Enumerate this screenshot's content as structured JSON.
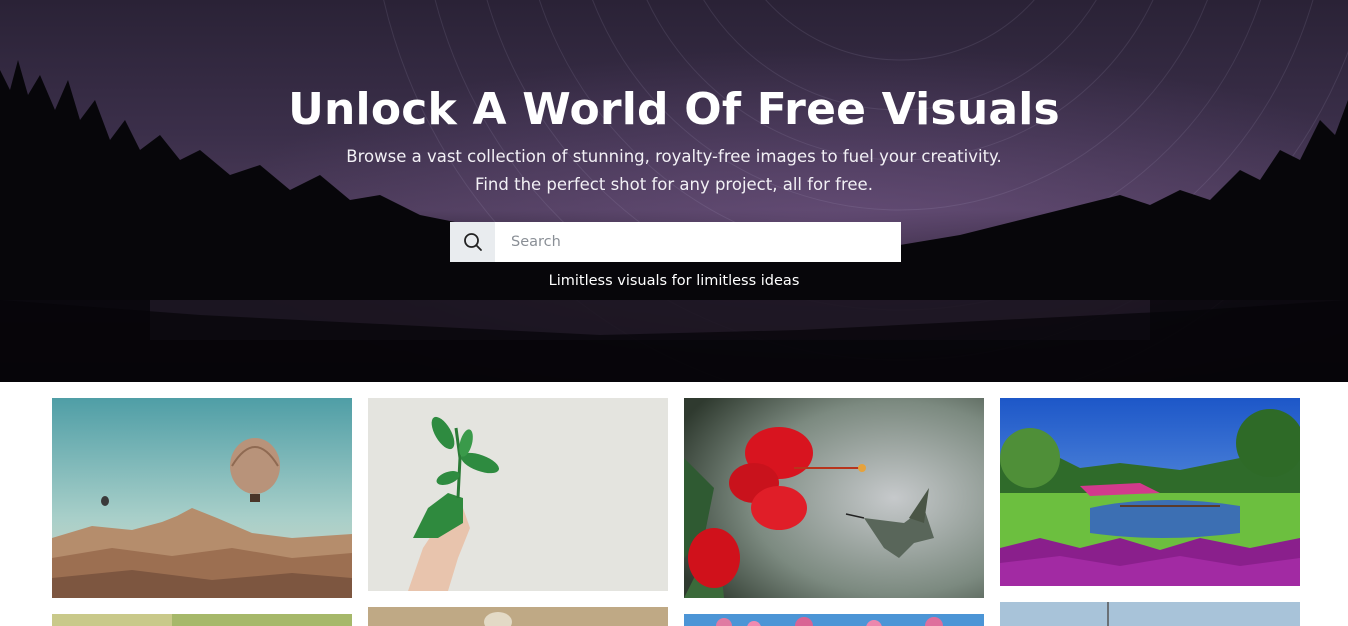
{
  "hero": {
    "title": "Unlock A World Of Free Visuals",
    "subtitle_line1": "Browse a vast collection of stunning, royalty-free images to fuel your creativity.",
    "subtitle_line2": "Find the perfect shot for any project, all for free.",
    "tagline": "Limitless visuals for limitless ideas",
    "background": "night-sky-lake-forest-star-trails"
  },
  "search": {
    "placeholder": "Search",
    "value": "",
    "icon": "search-icon"
  },
  "gallery": {
    "photos": [
      {
        "subject": "hot-air-balloon-over-cappadocia"
      },
      {
        "subject": "hand-holding-green-plant"
      },
      {
        "subject": "hummingbird-and-red-hibiscus"
      },
      {
        "subject": "garden-lake-with-flowers"
      },
      {
        "subject": "green-field-partial"
      },
      {
        "subject": "sand-partial"
      },
      {
        "subject": "pink-blossoms-partial"
      },
      {
        "subject": "sky-mast-partial"
      }
    ]
  },
  "colors": {
    "search_icon_bg": "#e9ecef",
    "hero_text": "#ffffff"
  }
}
